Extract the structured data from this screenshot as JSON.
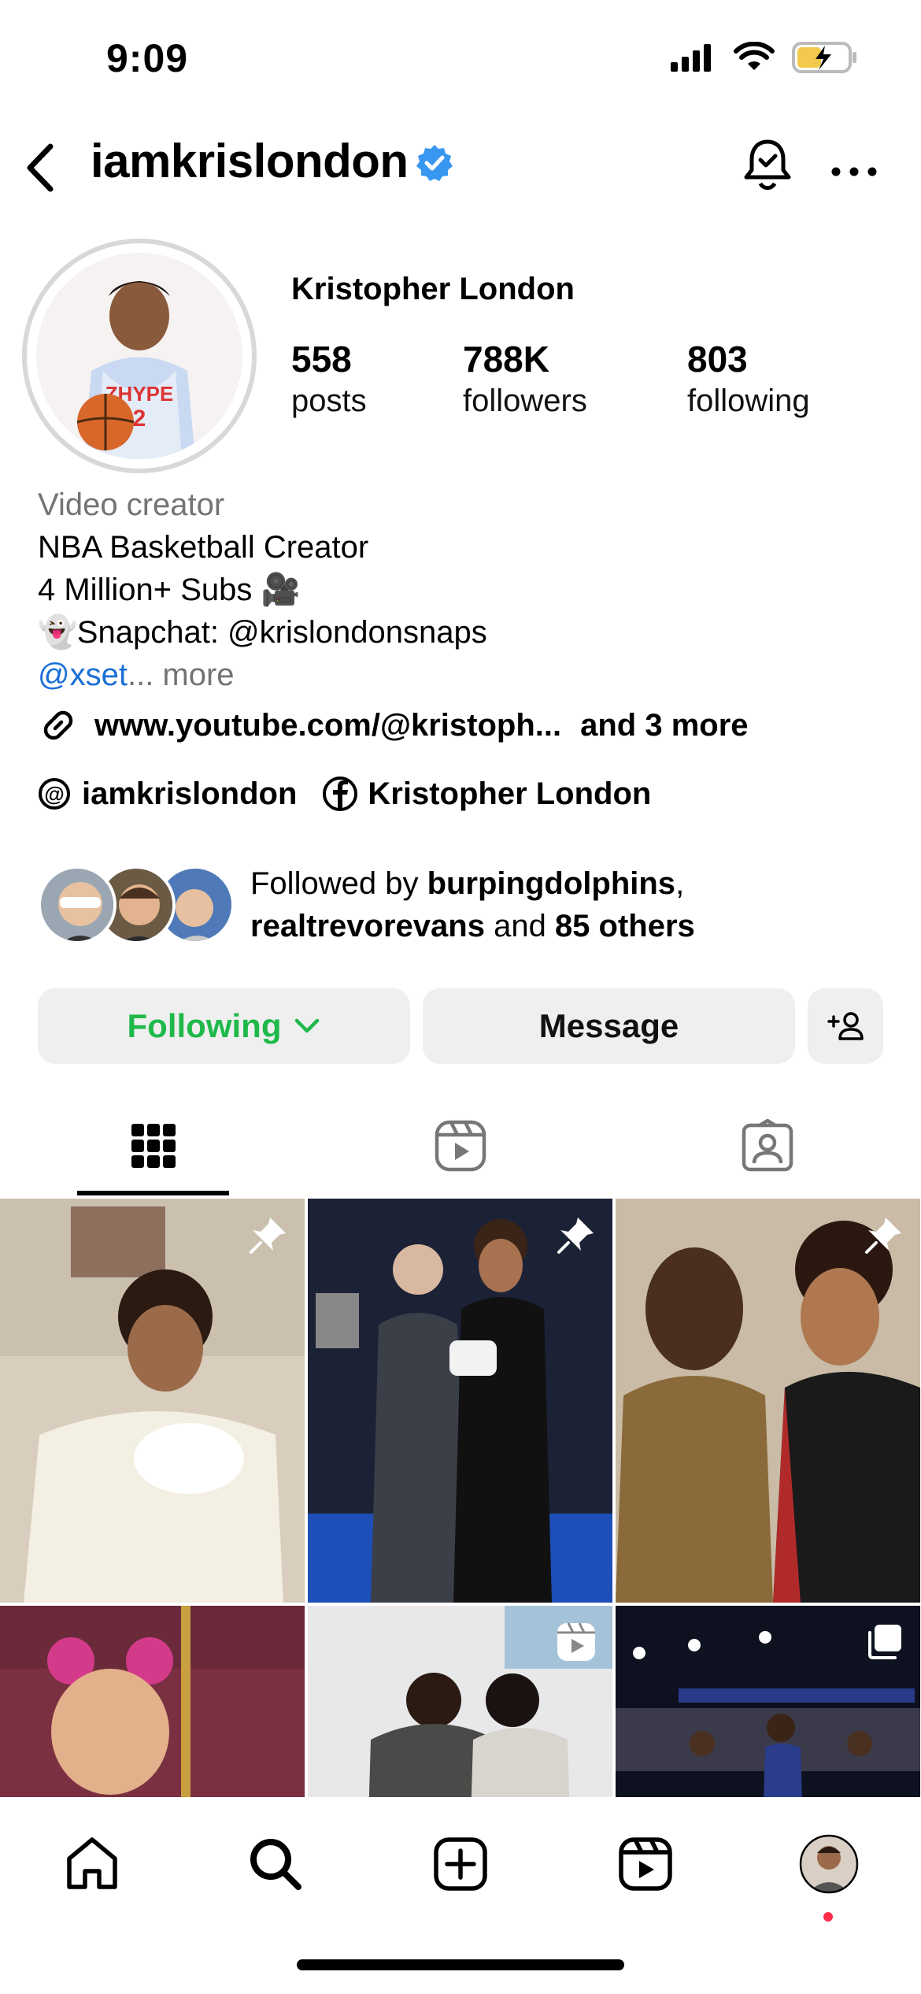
{
  "status_bar": {
    "time": "9:09"
  },
  "header": {
    "username": "iamkrislondon"
  },
  "profile": {
    "full_name": "Kristopher London",
    "stats": [
      {
        "value": "558",
        "label": "posts"
      },
      {
        "value": "788K",
        "label": "followers"
      },
      {
        "value": "803",
        "label": "following"
      }
    ],
    "category": "Video creator",
    "bio_lines": [
      "NBA Basketball Creator",
      "4 Million+ Subs 🎥",
      "👻Snapchat: @krislondonsnaps"
    ],
    "bio_mention": "@xset",
    "bio_more": "... more",
    "link": "www.youtube.com/@kristoph...",
    "link_more": "and 3 more",
    "threads_handle": "iamkrislondon",
    "facebook_name": "Kristopher London",
    "followed_by": {
      "prefix": "Followed by ",
      "user1": "burpingdolphins",
      "comma": ",",
      "user2": "realtrevorevans",
      "mid": " and ",
      "others": "85 others"
    }
  },
  "actions": {
    "following_label": "Following",
    "message_label": "Message"
  },
  "tabs": [
    "grid-tab",
    "reels-tab",
    "tagged-tab"
  ],
  "grid_posts": [
    {
      "badge": "pin"
    },
    {
      "badge": "pin"
    },
    {
      "badge": "pin"
    },
    {
      "badge": "none"
    },
    {
      "badge": "reel"
    },
    {
      "badge": "carousel"
    }
  ],
  "colors": {
    "accent_green": "#1fb94a",
    "link_blue": "#1a6fd6",
    "verified_blue": "#3897f0",
    "notification_red": "#ff2d4a"
  }
}
